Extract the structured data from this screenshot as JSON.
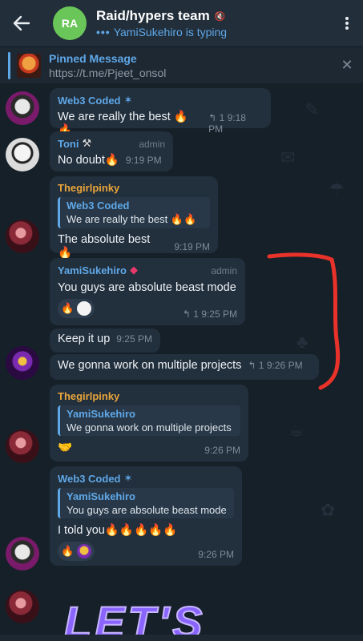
{
  "header": {
    "avatar_initials": "RA",
    "title": "Raid/hypers team",
    "typing_status": "YamiSukehiro is typing",
    "back_icon": "arrow-left-icon",
    "muted_icon": "muted-icon",
    "menu_icon": "more-vertical-icon"
  },
  "pinned": {
    "title": "Pinned Message",
    "link": "https://t.me/Pjeet_onsol",
    "close_icon": "close-icon"
  },
  "messages": [
    {
      "sender": "Web3 Coded",
      "text": "We are really the best 🔥🔥",
      "time": "9:18 PM",
      "reply_count": "1"
    },
    {
      "sender": "Toni",
      "role": "admin",
      "text": "No doubt🔥",
      "time": "9:19 PM"
    },
    {
      "sender": "Thegirlpinky",
      "reply_to": "Web3 Coded",
      "reply_text": "We are really the best 🔥🔥",
      "text": "The absolute best 🔥",
      "time": "9:19 PM"
    },
    {
      "sender": "YamiSukehiro",
      "role": "admin",
      "text": "You guys are absolute beast mode",
      "time": "9:25 PM",
      "reply_count": "1",
      "reaction": "🔥"
    },
    {
      "text": "Keep it up",
      "time": "9:25 PM"
    },
    {
      "text": "We gonna work on multiple projects",
      "time": "9:26 PM",
      "reply_count": "1"
    },
    {
      "sender": "Thegirlpinky",
      "reply_to": "YamiSukehiro",
      "reply_text": "We gonna work on multiple projects",
      "text": "🤝",
      "time": "9:26 PM"
    },
    {
      "sender": "Web3 Coded",
      "reply_to": "YamiSukehiro",
      "reply_text": "You guys are absolute beast mode",
      "text": "I told you🔥🔥🔥🔥🔥",
      "time": "9:26 PM",
      "reaction": "🔥"
    }
  ],
  "sticker_text": "LET'S",
  "colors": {
    "accent": "#5fa8e8",
    "sender_orange": "#e9a53b",
    "scribble": "#e8322a"
  }
}
